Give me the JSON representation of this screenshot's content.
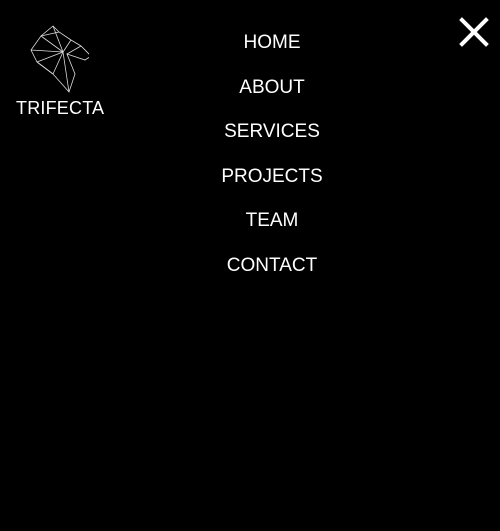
{
  "brand": {
    "name": "TRIFECTA",
    "logo_icon": "geometric-horse-head"
  },
  "nav": {
    "items": [
      {
        "label": "HOME"
      },
      {
        "label": "ABOUT"
      },
      {
        "label": "SERVICES"
      },
      {
        "label": "PROJECTS"
      },
      {
        "label": "TEAM"
      },
      {
        "label": "CONTACT"
      }
    ]
  },
  "close": {
    "icon": "close-x"
  }
}
